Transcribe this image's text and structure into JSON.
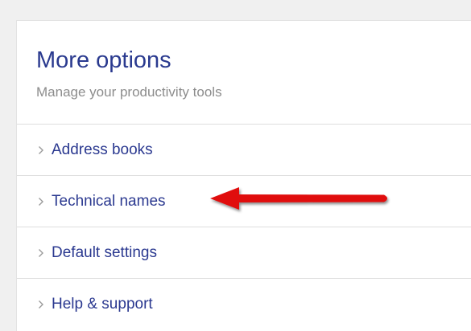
{
  "panel": {
    "title": "More options",
    "subtitle": "Manage your productivity tools"
  },
  "menu": {
    "items": [
      {
        "label": "Address books",
        "icon": "chevron-right-icon"
      },
      {
        "label": "Technical names",
        "icon": "chevron-right-icon"
      },
      {
        "label": "Default settings",
        "icon": "chevron-right-icon"
      },
      {
        "label": "Help & support",
        "icon": "chevron-right-icon"
      }
    ]
  },
  "annotation": {
    "type": "red-arrow",
    "points_to": "Technical names",
    "color": "#e01010"
  },
  "colors": {
    "title": "#2a3a8f",
    "link": "#2b3990",
    "subtitle": "#8c8c8c",
    "divider": "#dedede",
    "page_background": "#f0f0f0"
  }
}
